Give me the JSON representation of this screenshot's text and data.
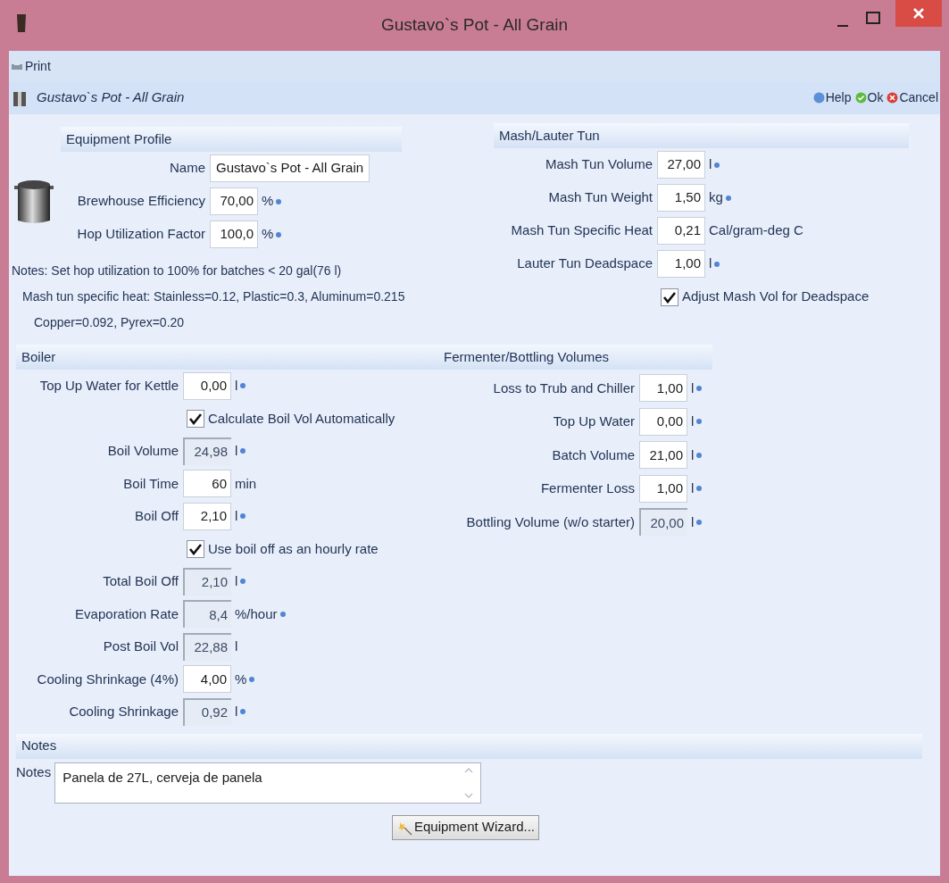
{
  "window": {
    "title": "Gustavo`s Pot - All Grain"
  },
  "toolbar": {
    "print": "Print"
  },
  "header": {
    "title": "Gustavo`s Pot - All Grain",
    "help": "Help",
    "ok": "Ok",
    "cancel": "Cancel"
  },
  "equipment_profile": {
    "heading": "Equipment Profile",
    "rows": [
      {
        "kind": "text",
        "label": "Name",
        "value": "Gustavo`s Pot - All Grain"
      },
      {
        "kind": "field",
        "label": "Brewhouse Efficiency",
        "value": "70,00",
        "unit": "%",
        "info": true,
        "readonly": false
      },
      {
        "kind": "field",
        "label": "Hop Utilization Factor",
        "value": "100,0",
        "unit": "%",
        "info": true,
        "readonly": false
      }
    ]
  },
  "hints": [
    "Notes: Set hop utilization to 100% for batches < 20 gal(76 l)",
    "Mash tun specific heat: Stainless=0.12, Plastic=0.3, Aluminum=0.215",
    "Copper=0.092, Pyrex=0.20"
  ],
  "mash_lauter_tun": {
    "heading": "Mash/Lauter Tun",
    "rows": [
      {
        "kind": "field",
        "label": "Mash Tun Volume",
        "value": "27,00",
        "unit": "l",
        "info": true,
        "readonly": false
      },
      {
        "kind": "field",
        "label": "Mash Tun Weight",
        "value": "1,50",
        "unit": "kg",
        "info": true,
        "readonly": false
      },
      {
        "kind": "field",
        "label": "Mash Tun Specific Heat",
        "value": "0,21",
        "unit": "Cal/gram-deg C",
        "info": false,
        "readonly": false
      },
      {
        "kind": "field",
        "label": "Lauter Tun Deadspace",
        "value": "1,00",
        "unit": "l",
        "info": true,
        "readonly": false
      },
      {
        "kind": "checkbox",
        "label": "Adjust Mash Vol for Deadspace",
        "checked": true
      }
    ]
  },
  "boiler": {
    "heading": "Boiler",
    "rows": [
      {
        "kind": "field",
        "label": "Top Up Water for Kettle",
        "value": "0,00",
        "unit": "l",
        "info": true,
        "readonly": false
      },
      {
        "kind": "checkbox",
        "label": "Calculate Boil Vol Automatically",
        "checked": true
      },
      {
        "kind": "field",
        "label": "Boil Volume",
        "value": "24,98",
        "unit": "l",
        "info": true,
        "readonly": true
      },
      {
        "kind": "field",
        "label": "Boil Time",
        "value": "60",
        "unit": "min",
        "info": false,
        "readonly": false
      },
      {
        "kind": "field",
        "label": "Boil Off",
        "value": "2,10",
        "unit": "l",
        "info": true,
        "readonly": false
      },
      {
        "kind": "checkbox",
        "label": "Use boil off as an hourly rate",
        "checked": true
      },
      {
        "kind": "field",
        "label": "Total Boil Off",
        "value": "2,10",
        "unit": "l",
        "info": true,
        "readonly": true
      },
      {
        "kind": "field",
        "label": "Evaporation Rate",
        "value": "8,4",
        "unit": "%/hour",
        "info": true,
        "readonly": true
      },
      {
        "kind": "field",
        "label": "Post Boil Vol",
        "value": "22,88",
        "unit": "l",
        "info": false,
        "readonly": true
      },
      {
        "kind": "field",
        "label": "Cooling Shrinkage (4%)",
        "value": "4,00",
        "unit": "%",
        "info": true,
        "readonly": false
      },
      {
        "kind": "field",
        "label": "Cooling Shrinkage",
        "value": "0,92",
        "unit": "l",
        "info": true,
        "readonly": true
      }
    ]
  },
  "fermenter_bottling": {
    "heading": "Fermenter/Bottling Volumes",
    "rows": [
      {
        "kind": "field",
        "label": "Loss to Trub and Chiller",
        "value": "1,00",
        "unit": "l",
        "info": true,
        "readonly": false
      },
      {
        "kind": "field",
        "label": "Top Up Water",
        "value": "0,00",
        "unit": "l",
        "info": true,
        "readonly": false
      },
      {
        "kind": "field",
        "label": "Batch Volume",
        "value": "21,00",
        "unit": "l",
        "info": true,
        "readonly": false
      },
      {
        "kind": "field",
        "label": "Fermenter Loss",
        "value": "1,00",
        "unit": "l",
        "info": true,
        "readonly": false
      },
      {
        "kind": "field",
        "label": "Bottling Volume (w/o starter)",
        "value": "20,00",
        "unit": "l",
        "info": true,
        "readonly": true
      }
    ]
  },
  "notes": {
    "heading": "Notes",
    "label": "Notes",
    "value": "Panela de 27L, cerveja de panela"
  },
  "wizard_button": "Equipment Wizard..."
}
